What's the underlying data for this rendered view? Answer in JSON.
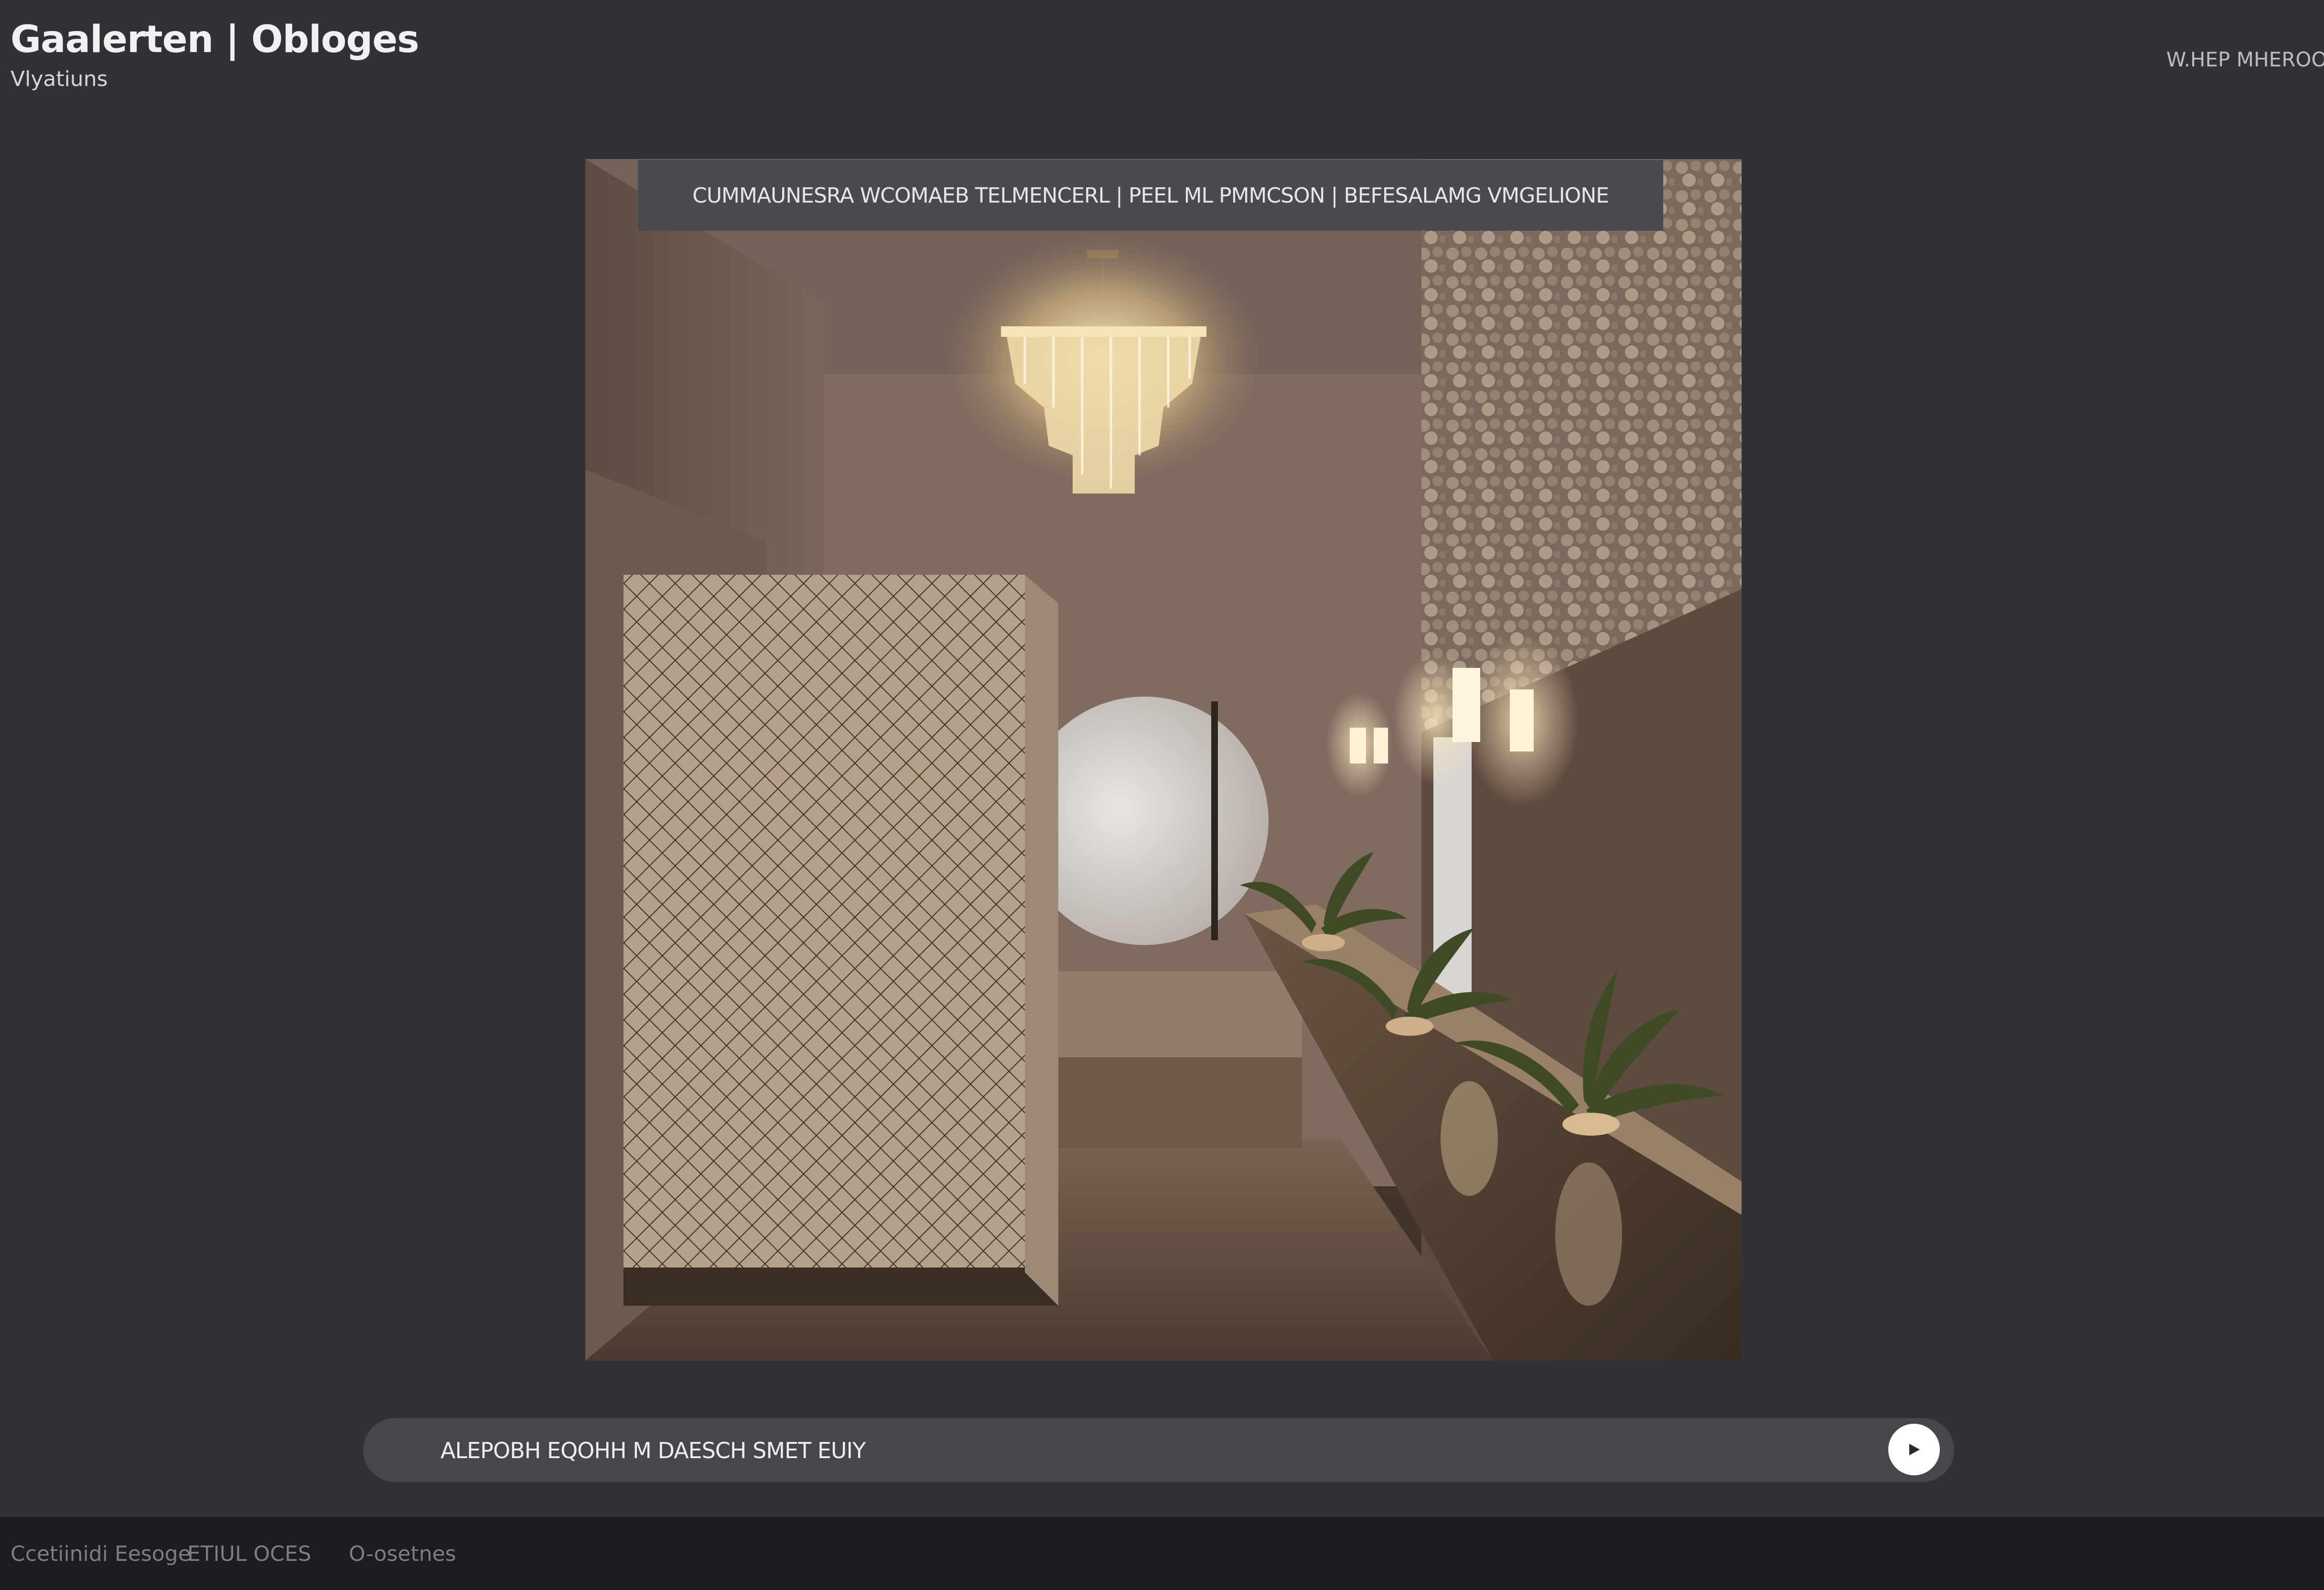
{
  "header": {
    "title": "Gaalerten | Obloges",
    "subtitle": "Vlyatiuns",
    "top_right_link": "W.HEP MHEROOG"
  },
  "image": {
    "caption": "CUMMAUNESRA WCOMAEB TELMENCERL | PEEL ML PMMCSON | BEFESALAMG VMGELIONE"
  },
  "prompt": {
    "value": "ALEPOBH EQOHH M DAESCH SMET EUIY",
    "send_icon": "play-icon"
  },
  "footer": {
    "items": [
      "Ccetiinidi Eesoge",
      "ETIUL OCES",
      "O-osetnes"
    ]
  },
  "colors": {
    "background": "#323236",
    "bottom_bar": "#1d1c20",
    "prompt_bar": "#46464b",
    "caption_bar": "#4a4a50"
  }
}
